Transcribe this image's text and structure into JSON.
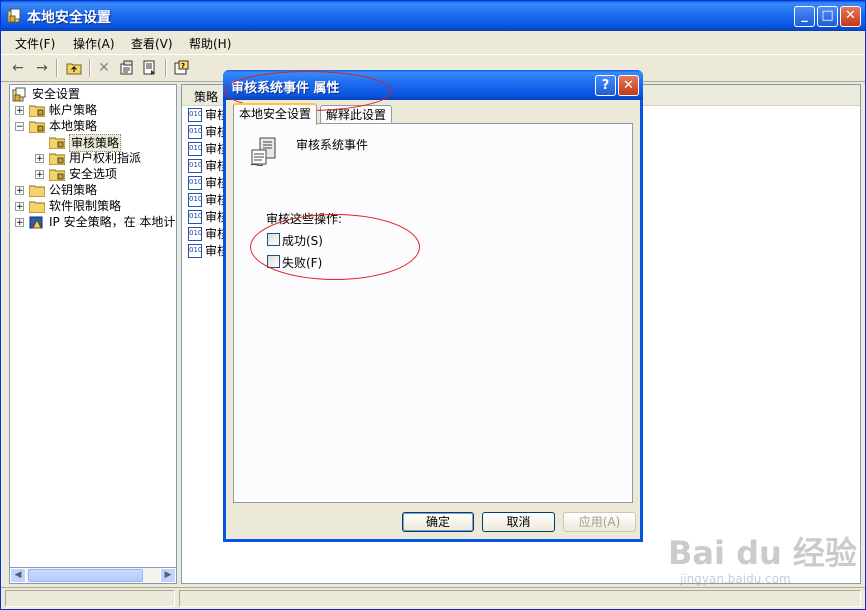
{
  "window": {
    "title": "本地安全设置",
    "min": "_",
    "max": "□",
    "close": "✕"
  },
  "menu": [
    {
      "label": "文件(F)"
    },
    {
      "label": "操作(A)"
    },
    {
      "label": "查看(V)"
    },
    {
      "label": "帮助(H)"
    }
  ],
  "tree": {
    "root": "安全设置",
    "account_policy": "帐户策略",
    "local_policy": "本地策略",
    "audit_policy": "审核策略",
    "user_rights": "用户权利指派",
    "security_options": "安全选项",
    "public_key": "公钥策略",
    "software_restriction": "软件限制策略",
    "ip_security": "IP 安全策略，在 本地计"
  },
  "list": {
    "header": "策略",
    "rows": [
      "审核",
      "审核",
      "审核",
      "审核",
      "审核",
      "审核",
      "审核",
      "审核",
      "审核"
    ]
  },
  "dialog": {
    "title": "审核系统事件 属性",
    "help": "?",
    "close": "✕",
    "tabs": {
      "local": "本地安全设置",
      "explain": "解释此设置"
    },
    "policy_name": "审核系统事件",
    "group_label": "审核这些操作:",
    "success": "成功(S)",
    "failure": "失败(F)",
    "ok": "确定",
    "cancel": "取消",
    "apply": "应用(A)"
  },
  "watermark": {
    "brand": "Bai du 经验",
    "url": "jingyan.baidu.com"
  }
}
